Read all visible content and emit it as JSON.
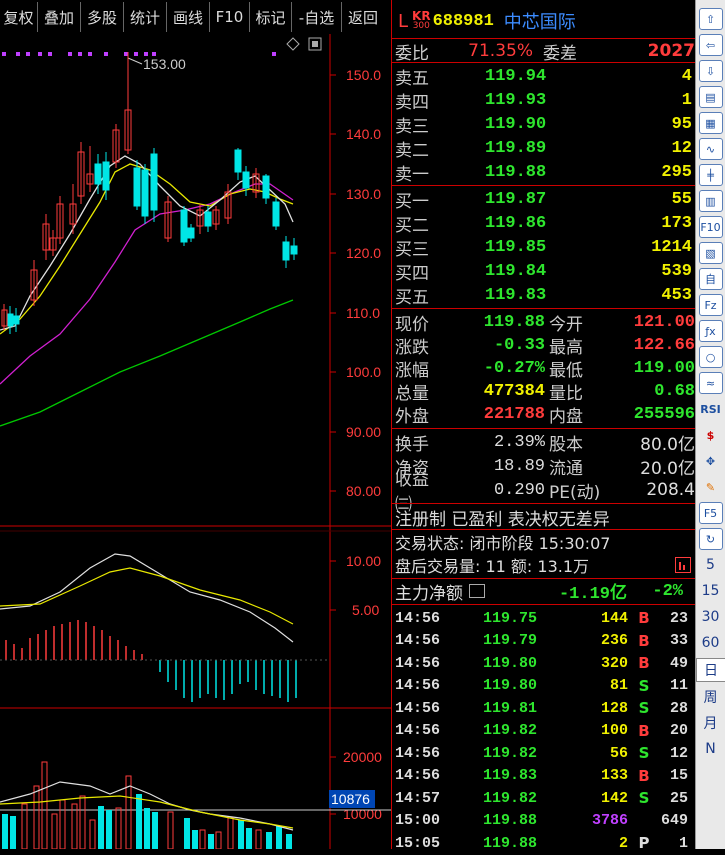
{
  "toolbar": [
    "复权",
    "叠加",
    "多股",
    "统计",
    "画线",
    "F10",
    "标记",
    "-自选",
    "返回"
  ],
  "chart": {
    "price_axis": [
      "150.0",
      "140.0",
      "130.0",
      "120.0",
      "110.0",
      "100.0",
      "90.00",
      "80.00"
    ],
    "peak_label": "153.00",
    "macd_axis": [
      "10.00",
      "5.00"
    ],
    "vol_axis": [
      "20000",
      "10000"
    ],
    "vol_marker": "10876"
  },
  "header": {
    "prefix": "L",
    "kr_top": "KR",
    "kr_bottom": "300",
    "code": "688981",
    "name": "中芯国际"
  },
  "committee": {
    "ratio_label": "委比",
    "ratio": "71.35%",
    "diff_label": "委差",
    "diff": "2027"
  },
  "asks": [
    {
      "label": "卖五",
      "price": "119.94",
      "vol": "4"
    },
    {
      "label": "卖四",
      "price": "119.93",
      "vol": "1"
    },
    {
      "label": "卖三",
      "price": "119.90",
      "vol": "95"
    },
    {
      "label": "卖二",
      "price": "119.89",
      "vol": "12"
    },
    {
      "label": "卖一",
      "price": "119.88",
      "vol": "295"
    }
  ],
  "bids": [
    {
      "label": "买一",
      "price": "119.87",
      "vol": "55"
    },
    {
      "label": "买二",
      "price": "119.86",
      "vol": "173"
    },
    {
      "label": "买三",
      "price": "119.85",
      "vol": "1214"
    },
    {
      "label": "买四",
      "price": "119.84",
      "vol": "539"
    },
    {
      "label": "买五",
      "price": "119.83",
      "vol": "453"
    }
  ],
  "quote": [
    {
      "l1": "现价",
      "v1": "119.88",
      "c1": "green",
      "l2": "今开",
      "v2": "121.00",
      "c2": "red"
    },
    {
      "l1": "涨跌",
      "v1": "-0.33",
      "c1": "green",
      "l2": "最高",
      "v2": "122.66",
      "c2": "red"
    },
    {
      "l1": "涨幅",
      "v1": "-0.27%",
      "c1": "green",
      "l2": "最低",
      "v2": "119.00",
      "c2": "green"
    },
    {
      "l1": "总量",
      "v1": "477384",
      "c1": "yellow",
      "l2": "量比",
      "v2": "0.68",
      "c2": "green"
    },
    {
      "l1": "外盘",
      "v1": "221788",
      "c1": "red",
      "l2": "内盘",
      "v2": "255596",
      "c2": "green"
    }
  ],
  "stats": [
    {
      "l1": "换手",
      "v1": "2.39%",
      "l2": "股本",
      "v2": "80.0亿"
    },
    {
      "l1": "净资",
      "v1": "18.89",
      "l2": "流通",
      "v2": "20.0亿"
    },
    {
      "l1": "收益㈢",
      "v1": "0.290",
      "l2": "PE(动)",
      "v2": "208.4"
    }
  ],
  "note": "注册制 已盈利 表决权无差异",
  "status": "交易状态: 闭市阶段 15:30:07",
  "after_hours": "盘后交易量: 11  额: 13.1万",
  "mainflow": {
    "label": "主力净额",
    "value": "-1.19亿",
    "pct": "-2%"
  },
  "ticks": [
    {
      "t": "14:56",
      "p": "119.75",
      "v": "144",
      "bs": "B",
      "n": "23"
    },
    {
      "t": "14:56",
      "p": "119.79",
      "v": "236",
      "bs": "B",
      "n": "33"
    },
    {
      "t": "14:56",
      "p": "119.80",
      "v": "320",
      "bs": "B",
      "n": "49"
    },
    {
      "t": "14:56",
      "p": "119.80",
      "v": "81",
      "bs": "S",
      "n": "11"
    },
    {
      "t": "14:56",
      "p": "119.81",
      "v": "128",
      "bs": "S",
      "n": "28"
    },
    {
      "t": "14:56",
      "p": "119.82",
      "v": "100",
      "bs": "B",
      "n": "20"
    },
    {
      "t": "14:56",
      "p": "119.82",
      "v": "56",
      "bs": "S",
      "n": "12"
    },
    {
      "t": "14:56",
      "p": "119.83",
      "v": "133",
      "bs": "B",
      "n": "15"
    },
    {
      "t": "14:57",
      "p": "119.82",
      "v": "142",
      "bs": "S",
      "n": "25"
    },
    {
      "t": "15:00",
      "p": "119.88",
      "v": "3786",
      "bs": "",
      "n": "649"
    },
    {
      "t": "15:05",
      "p": "119.88",
      "v": "2",
      "bs": "P",
      "n": "1"
    }
  ],
  "side_text": [
    "5",
    "15",
    "30",
    "60",
    "日",
    "周",
    "月",
    "N"
  ]
}
